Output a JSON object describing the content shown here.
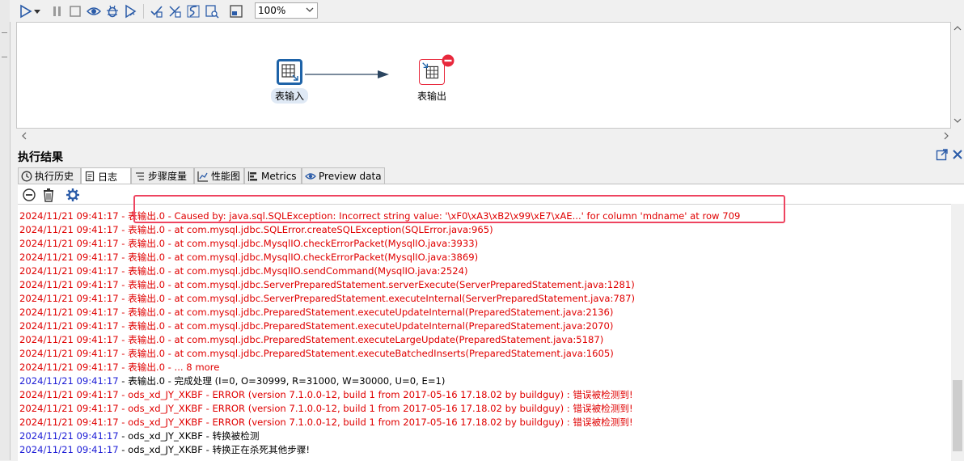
{
  "toolbar": {
    "zoom": "100%",
    "icons": [
      "run-icon",
      "run-dropdown-icon",
      "pause-icon",
      "stop-icon",
      "preview-icon",
      "debug-icon",
      "replay-icon",
      "verify-icon",
      "analyze-icon",
      "sql-icon",
      "explore-db-icon",
      "show-results-icon"
    ]
  },
  "canvas": {
    "step1_label": "表输入",
    "step2_label": "表输出"
  },
  "results": {
    "title": "执行结果",
    "tabs": {
      "history": "执行历史",
      "log": "日志",
      "step_metrics": "步骤度量",
      "perf_chart": "性能图",
      "metrics": "Metrics",
      "preview": "Preview data"
    }
  },
  "log": {
    "partial_top": "... ...",
    "lines": [
      {
        "ts": "2024/11/21 09:41:17",
        "msg": "表输出.0 - Caused by: java.sql.SQLException: Incorrect string value: '\\xF0\\xA3\\xB2\\x99\\xE7\\xAE...' for column 'mdname' at row 709",
        "level": "error"
      },
      {
        "ts": "2024/11/21 09:41:17",
        "msg": "表输出.0 -  at com.mysql.jdbc.SQLError.createSQLException(SQLError.java:965)",
        "level": "error"
      },
      {
        "ts": "2024/11/21 09:41:17",
        "msg": "表输出.0 -  at com.mysql.jdbc.MysqlIO.checkErrorPacket(MysqlIO.java:3933)",
        "level": "error"
      },
      {
        "ts": "2024/11/21 09:41:17",
        "msg": "表输出.0 -  at com.mysql.jdbc.MysqlIO.checkErrorPacket(MysqlIO.java:3869)",
        "level": "error"
      },
      {
        "ts": "2024/11/21 09:41:17",
        "msg": "表输出.0 -  at com.mysql.jdbc.MysqlIO.sendCommand(MysqlIO.java:2524)",
        "level": "error"
      },
      {
        "ts": "2024/11/21 09:41:17",
        "msg": "表输出.0 -  at com.mysql.jdbc.ServerPreparedStatement.serverExecute(ServerPreparedStatement.java:1281)",
        "level": "error"
      },
      {
        "ts": "2024/11/21 09:41:17",
        "msg": "表输出.0 -  at com.mysql.jdbc.ServerPreparedStatement.executeInternal(ServerPreparedStatement.java:787)",
        "level": "error"
      },
      {
        "ts": "2024/11/21 09:41:17",
        "msg": "表输出.0 -  at com.mysql.jdbc.PreparedStatement.executeUpdateInternal(PreparedStatement.java:2136)",
        "level": "error"
      },
      {
        "ts": "2024/11/21 09:41:17",
        "msg": "表输出.0 -  at com.mysql.jdbc.PreparedStatement.executeUpdateInternal(PreparedStatement.java:2070)",
        "level": "error"
      },
      {
        "ts": "2024/11/21 09:41:17",
        "msg": "表输出.0 -  at com.mysql.jdbc.PreparedStatement.executeLargeUpdate(PreparedStatement.java:5187)",
        "level": "error"
      },
      {
        "ts": "2024/11/21 09:41:17",
        "msg": "表输出.0 -  at com.mysql.jdbc.PreparedStatement.executeBatchedInserts(PreparedStatement.java:1605)",
        "level": "error"
      },
      {
        "ts": "2024/11/21 09:41:17",
        "msg": "表输出.0 -  ... 8 more",
        "level": "error"
      },
      {
        "ts": "2024/11/21 09:41:17",
        "msg": "表输出.0 - 完成处理 (I=0, O=30999, R=31000, W=30000, U=0, E=1)",
        "level": "info"
      },
      {
        "ts": "2024/11/21 09:41:17",
        "msg": "ods_xd_JY_XKBF - ERROR (version 7.1.0.0-12, build 1 from 2017-05-16 17.18.02 by buildguy) : 错误被检测到!",
        "level": "error"
      },
      {
        "ts": "2024/11/21 09:41:17",
        "msg": "ods_xd_JY_XKBF - ERROR (version 7.1.0.0-12, build 1 from 2017-05-16 17.18.02 by buildguy) : 错误被检测到!",
        "level": "error"
      },
      {
        "ts": "2024/11/21 09:41:17",
        "msg": "ods_xd_JY_XKBF - ERROR (version 7.1.0.0-12, build 1 from 2017-05-16 17.18.02 by buildguy) : 错误被检测到!",
        "level": "error"
      },
      {
        "ts": "2024/11/21 09:41:17",
        "msg": "ods_xd_JY_XKBF - 转换被检测",
        "level": "info"
      },
      {
        "ts": "2024/11/21 09:41:17",
        "msg": "ods_xd_JY_XKBF - 转换正在杀死其他步骤!",
        "level": "info"
      }
    ]
  },
  "colors": {
    "error": "#e00000",
    "timestamp_info": "#1c1cd6",
    "highlight": "#ee4460",
    "step_input": "#1e63a8",
    "step_output_error": "#e8283c"
  }
}
